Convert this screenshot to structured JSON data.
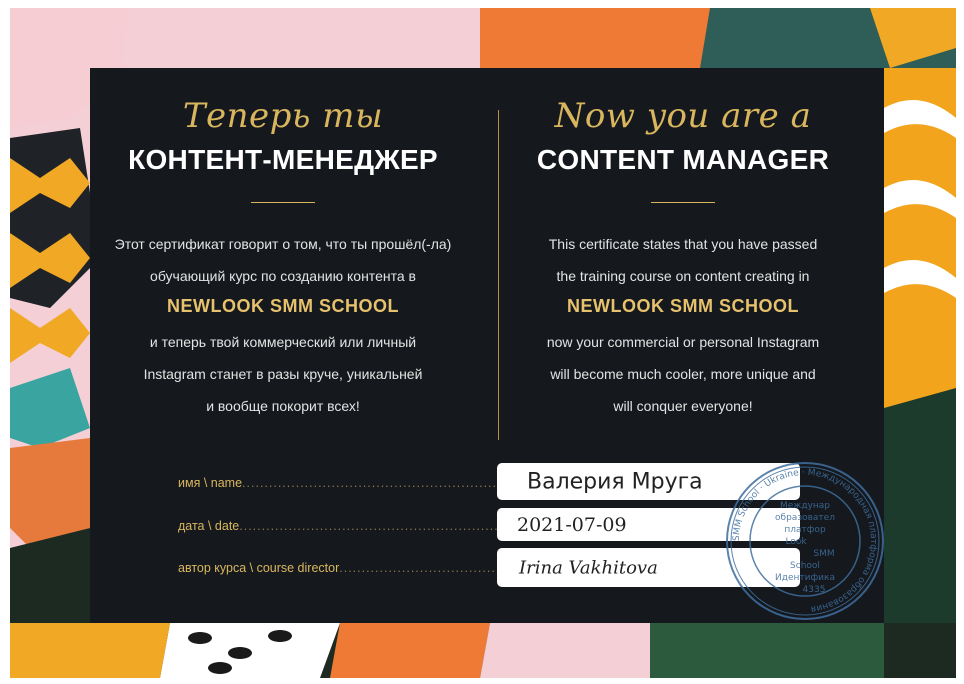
{
  "left": {
    "script": "Теперь ты",
    "heading": "КОНТЕНТ-МЕНЕДЖЕР",
    "line1": "Этот сертификат говорит о том, что ты прошёл(-ла)",
    "line2": "обучающий курс по созданию контента в",
    "school": "NEWLOOK SMM SCHOOL",
    "line3": "и теперь твой коммерческий или личный",
    "line4": "Instagram станет в разы круче, уникальней",
    "line5": "и вообще покорит всех!"
  },
  "right": {
    "script": "Now you are a",
    "heading": "CONTENT MANAGER",
    "line1": "This certificate states that you have passed",
    "line2": "the training course on content creating in",
    "school": "NEWLOOK SMM SCHOOL",
    "line3": "now your commercial or personal Instagram",
    "line4": "will become much cooler, more unique and",
    "line5": "will conquer everyone!"
  },
  "fields": {
    "name_label": "имя \\ name",
    "name_value": "Валерия Мруга",
    "date_label": "дата \\ date",
    "date_value": "2021-07-09",
    "director_label": "автор курса \\ course director",
    "director_value": "Irina Vakhitova"
  },
  "stamp": {
    "outer_text": "SMM School · Ukraine · Международная платформа образования",
    "line1": "Междунар",
    "line2": "образовател",
    "line3": "платфор",
    "line4": "Look",
    "line5": "SMM",
    "line6": "School",
    "line7": "Идентифика",
    "line8": "4335"
  },
  "colors": {
    "panel": "#15191e",
    "gold": "#d9b65e",
    "stamp": "#3f6e9e"
  }
}
